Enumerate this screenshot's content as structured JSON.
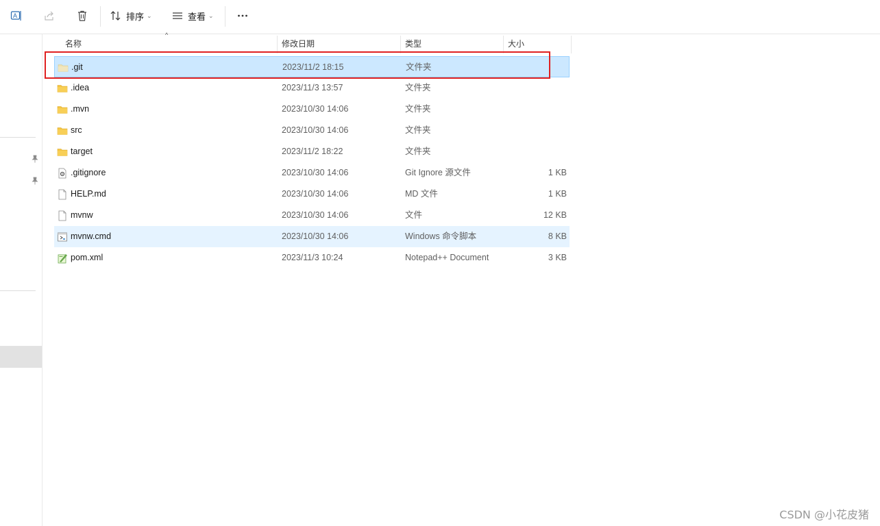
{
  "toolbar": {
    "rename_icon": "rename-icon",
    "share_icon": "share-icon",
    "delete_icon": "trash-icon",
    "sort_label": "排序",
    "view_label": "查看",
    "more_icon": "more-icon"
  },
  "columns": {
    "name": "名称",
    "date": "修改日期",
    "type": "类型",
    "size": "大小"
  },
  "files": [
    {
      "name": ".git",
      "date": "2023/11/2 18:15",
      "type": "文件夹",
      "size": "",
      "icon": "folder-hidden-icon"
    },
    {
      "name": ".idea",
      "date": "2023/11/3 13:57",
      "type": "文件夹",
      "size": "",
      "icon": "folder-icon"
    },
    {
      "name": ".mvn",
      "date": "2023/10/30 14:06",
      "type": "文件夹",
      "size": "",
      "icon": "folder-icon"
    },
    {
      "name": "src",
      "date": "2023/10/30 14:06",
      "type": "文件夹",
      "size": "",
      "icon": "folder-icon"
    },
    {
      "name": "target",
      "date": "2023/11/2 18:22",
      "type": "文件夹",
      "size": "",
      "icon": "folder-icon"
    },
    {
      "name": ".gitignore",
      "date": "2023/10/30 14:06",
      "type": "Git Ignore 源文件",
      "size": "1 KB",
      "icon": "config-file-icon"
    },
    {
      "name": "HELP.md",
      "date": "2023/10/30 14:06",
      "type": "MD 文件",
      "size": "1 KB",
      "icon": "file-icon"
    },
    {
      "name": "mvnw",
      "date": "2023/10/30 14:06",
      "type": "文件",
      "size": "12 KB",
      "icon": "file-icon"
    },
    {
      "name": "mvnw.cmd",
      "date": "2023/10/30 14:06",
      "type": "Windows 命令脚本",
      "size": "8 KB",
      "icon": "script-file-icon"
    },
    {
      "name": "pom.xml",
      "date": "2023/11/3 10:24",
      "type": "Notepad++ Document",
      "size": "3 KB",
      "icon": "notepadpp-file-icon"
    }
  ],
  "selected_index": 0,
  "hover_index": 8,
  "watermark": "CSDN @小花皮猪",
  "colors": {
    "selected_bg": "#cce8ff",
    "hover_bg": "#e5f3ff",
    "highlight_border": "#e02020",
    "folder": "#f5c542"
  }
}
